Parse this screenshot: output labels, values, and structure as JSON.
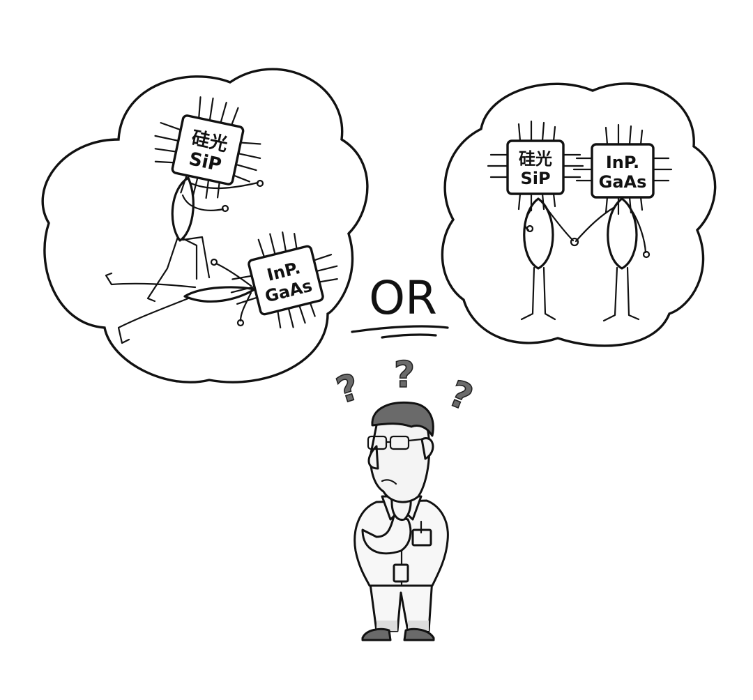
{
  "bubble_left": {
    "chip_sip": {
      "line1": "硅光",
      "line2": "SiP"
    },
    "chip_inp": {
      "line1": "InP.",
      "line2": "GaAs"
    }
  },
  "bubble_right": {
    "chip_sip": {
      "line1": "硅光",
      "line2": "SiP"
    },
    "chip_inp": {
      "line1": "InP.",
      "line2": "GaAs"
    }
  },
  "or_label": "OR",
  "question_marks": [
    "?",
    "?",
    "?"
  ],
  "colors": {
    "ink": "#111111",
    "hair": "#6a6a6a",
    "question_mark": "#6b6b6b",
    "background": "#ffffff"
  }
}
